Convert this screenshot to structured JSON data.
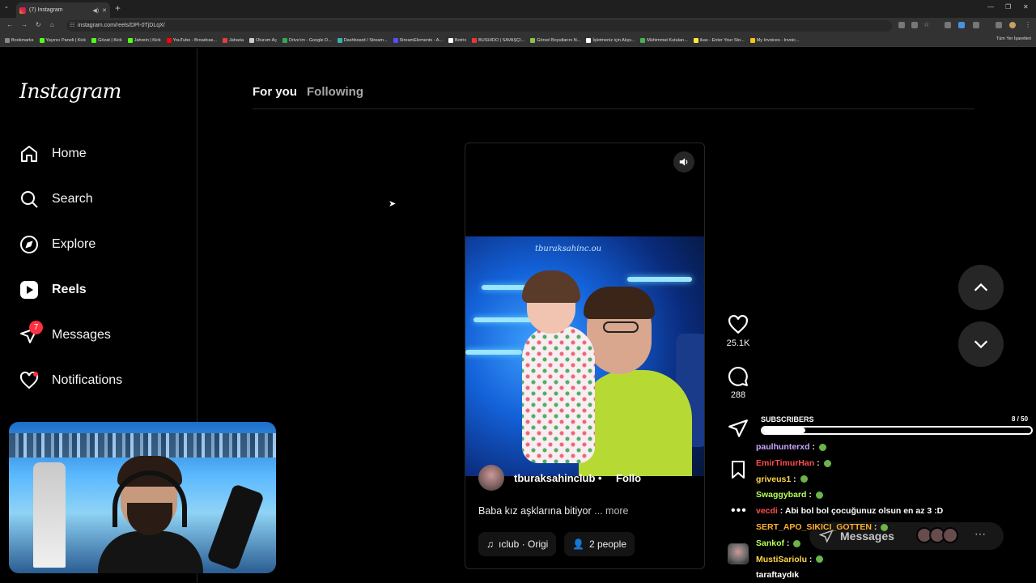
{
  "browser": {
    "tab_title": "(7) Instagram",
    "url": "instagram.com/reels/DPl-0TjDLqX/",
    "bookmarks": [
      {
        "label": "Bookmarks",
        "color": "#888888"
      },
      {
        "label": "Yayıncı Paneli | Kick",
        "color": "#53fc18"
      },
      {
        "label": "Gözat | Kick",
        "color": "#53fc18"
      },
      {
        "label": "Jahrein | Kick",
        "color": "#53fc18"
      },
      {
        "label": "YouTube - Broadcas...",
        "color": "#ff0000"
      },
      {
        "label": "Jaharia",
        "color": "#e04040"
      },
      {
        "label": "Oturum Aç",
        "color": "#cccccc"
      },
      {
        "label": "Drive'ım - Google D...",
        "color": "#34a853"
      },
      {
        "label": "Dashboard / Stream...",
        "color": "#38b2ac"
      },
      {
        "label": "StreamElements - A...",
        "color": "#5a4bff"
      },
      {
        "label": "Botrix",
        "color": "#ffffff"
      },
      {
        "label": "BUSHIDO | SAVAŞÇI...",
        "color": "#e53935"
      },
      {
        "label": "Görsel Boyutlarını N...",
        "color": "#8bc34a"
      },
      {
        "label": "İşletmeniz için Alışv...",
        "color": "#ffffff"
      },
      {
        "label": "Mühimmat Kutuları...",
        "color": "#4caf50"
      },
      {
        "label": "ikas - Enter Your Sto...",
        "color": "#ffeb3b"
      },
      {
        "label": "My Invoices - Invoic...",
        "color": "#f5c518"
      }
    ],
    "bookmarks_right": "Tüm Yer İşaretleri"
  },
  "sidebar": {
    "logo": "Instagram",
    "items": [
      {
        "label": "Home",
        "icon": "home-icon"
      },
      {
        "label": "Search",
        "icon": "search-icon"
      },
      {
        "label": "Explore",
        "icon": "explore-icon"
      },
      {
        "label": "Reels",
        "icon": "reels-icon"
      },
      {
        "label": "Messages",
        "icon": "messages-icon",
        "badge": "7"
      },
      {
        "label": "Notifications",
        "icon": "heart-icon"
      }
    ]
  },
  "feed": {
    "tab_for_you": "For you",
    "tab_following": "Following"
  },
  "reel": {
    "watermark": "tburaksahinc.ou",
    "author": "tburaksahinclub",
    "separator": "•",
    "follow": "Follo",
    "caption": "Baba kız aşklarına bitiyor",
    "more": "... more",
    "audio": "ıclub · Origi",
    "people": "2 people",
    "likes": "25.1K",
    "comments": "288"
  },
  "stream": {
    "subs_label": "SUBSCRIBERS",
    "subs_count": "8 / 50",
    "subs_progress": 0.16,
    "chat": [
      {
        "user": "paulhunterxd",
        "msg": "",
        "color": "#c9a7ff"
      },
      {
        "user": "EmirTimurHan",
        "msg": "",
        "color": "#ff4d4d"
      },
      {
        "user": "griveus1",
        "msg": "",
        "color": "#ffd54a"
      },
      {
        "user": "Swaggybard",
        "msg": "",
        "color": "#b7ff5a"
      },
      {
        "user": "vecdi",
        "msg": "Abi bol bol çocuğunuz olsun en az 3 :D",
        "color": "#ff4d4d"
      },
      {
        "user": "SERT_APO_SIKICI_GOTTEN",
        "msg": "",
        "color": "#ffb02e"
      },
      {
        "user": "Sankof",
        "msg": "",
        "color": "#b7ff5a"
      },
      {
        "user": "MustiSariolu",
        "msg": "",
        "color": "#ffd54a"
      },
      {
        "user": "",
        "msg": "taraftaydık",
        "color": "#ffffff"
      }
    ],
    "messages_pill": "Messages"
  }
}
